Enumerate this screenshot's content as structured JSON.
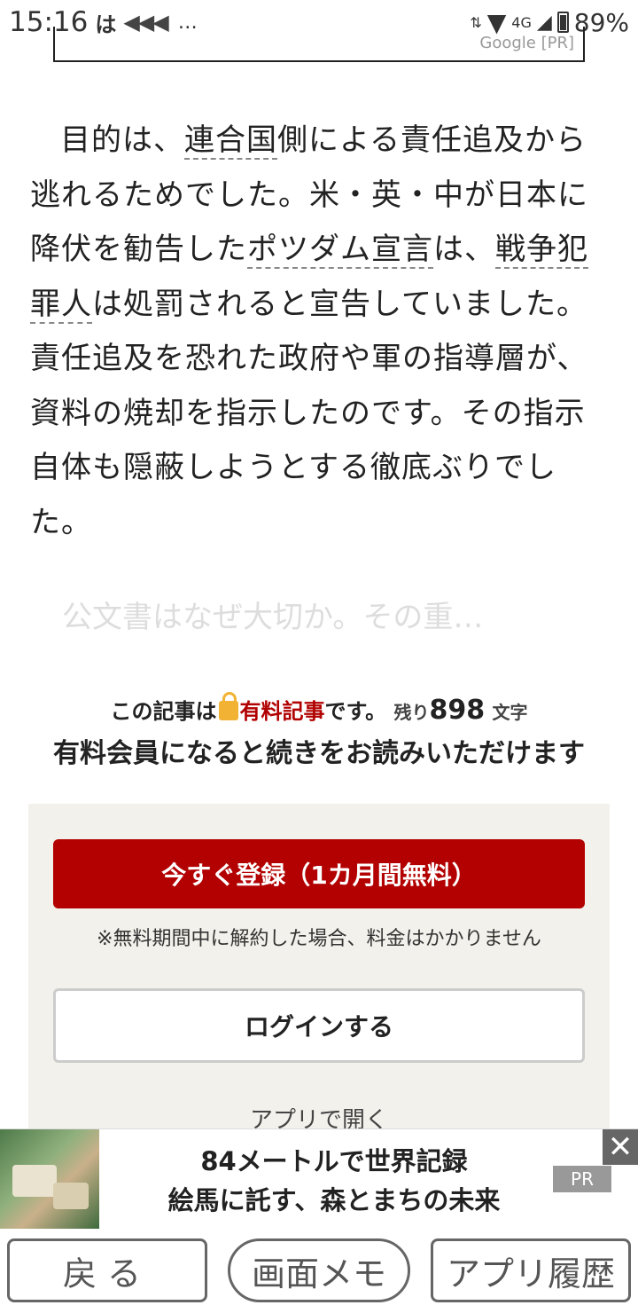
{
  "status_bar": {
    "time": "15:16",
    "app_glyph": "は",
    "notifications": "◀◀◀",
    "more": "…",
    "network": "4G",
    "battery": "89%"
  },
  "top_ad": {
    "label": "Google    [PR]"
  },
  "article": {
    "paragraph_parts": [
      "目的は、",
      "連合国",
      "側による責任追及から逃れるためでした。米・英・中が日本に降伏を勧告した",
      "ポツダム宣言",
      "は、",
      "戦争犯罪人",
      "は処罰されると宣告していました。責任追及を恐れた政府や軍の指導層が、資料の焼却を指示したのです。その指示自体も隠蔽しようとする徹底ぶりでした。"
    ],
    "faded_teaser": "公文書はなぜ大切か。その重…"
  },
  "paywall": {
    "line1_prefix": "この記事は",
    "line1_paid": "有料記事",
    "line1_suffix": "です。",
    "remaining_prefix": "残り",
    "remaining_count": "898",
    "remaining_unit": "文字",
    "line2": "有料会員になると続きをお読みいただけます",
    "register_button": "今すぐ登録（1カ月間無料）",
    "note": "※無料期間中に解約した場合、料金はかかりません",
    "login_button": "ログインする",
    "open_app": "アプリで開く"
  },
  "bottom_ad": {
    "line1": "84メートルで世界記録",
    "line2": "絵馬に託す、森とまちの未来",
    "pr_label": "PR",
    "close": "✕"
  },
  "bottom_nav": {
    "back": "戻る",
    "memo": "画面メモ",
    "history": "アプリ履歴"
  },
  "colors": {
    "accent_red": "#b30000",
    "panel_bg": "#f3f1eb"
  }
}
